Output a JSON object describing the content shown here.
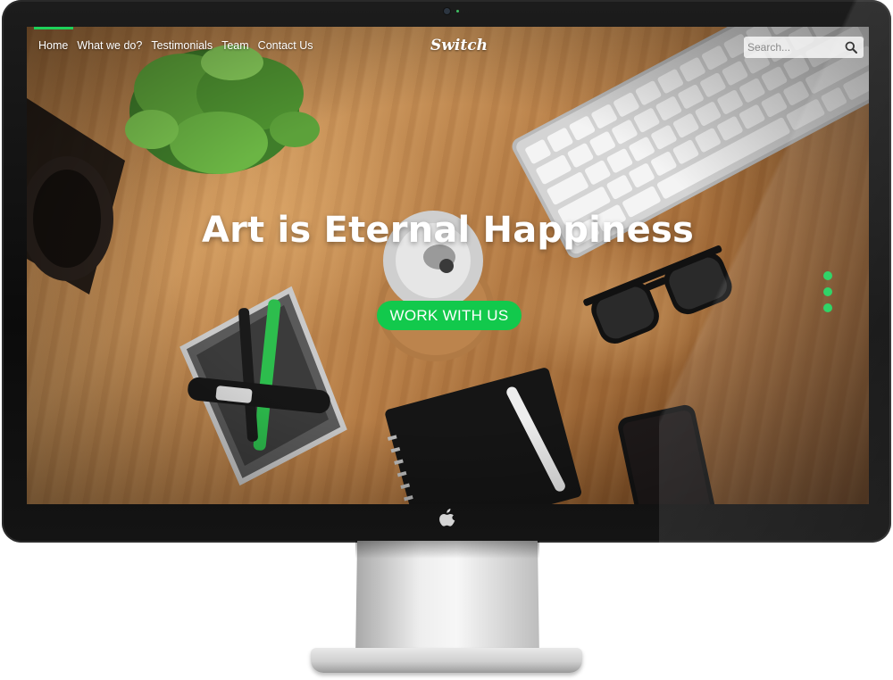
{
  "nav": {
    "items": [
      {
        "label": "Home",
        "active": true
      },
      {
        "label": "What we do?",
        "active": false
      },
      {
        "label": "Testimonials",
        "active": false
      },
      {
        "label": "Team",
        "active": false
      },
      {
        "label": "Contact Us",
        "active": false
      }
    ],
    "brand": "Switch",
    "search": {
      "placeholder": "Search...",
      "icon": "search-icon"
    }
  },
  "hero": {
    "title": "Art is Eternal Happiness",
    "cta_label": "WORK WITH US",
    "slide_count": 3,
    "active_slide": 1
  },
  "device": {
    "logo": "apple-logo-icon"
  },
  "colors": {
    "accent": "#12c94c",
    "text": "#ffffff",
    "bezel": "#111111"
  }
}
